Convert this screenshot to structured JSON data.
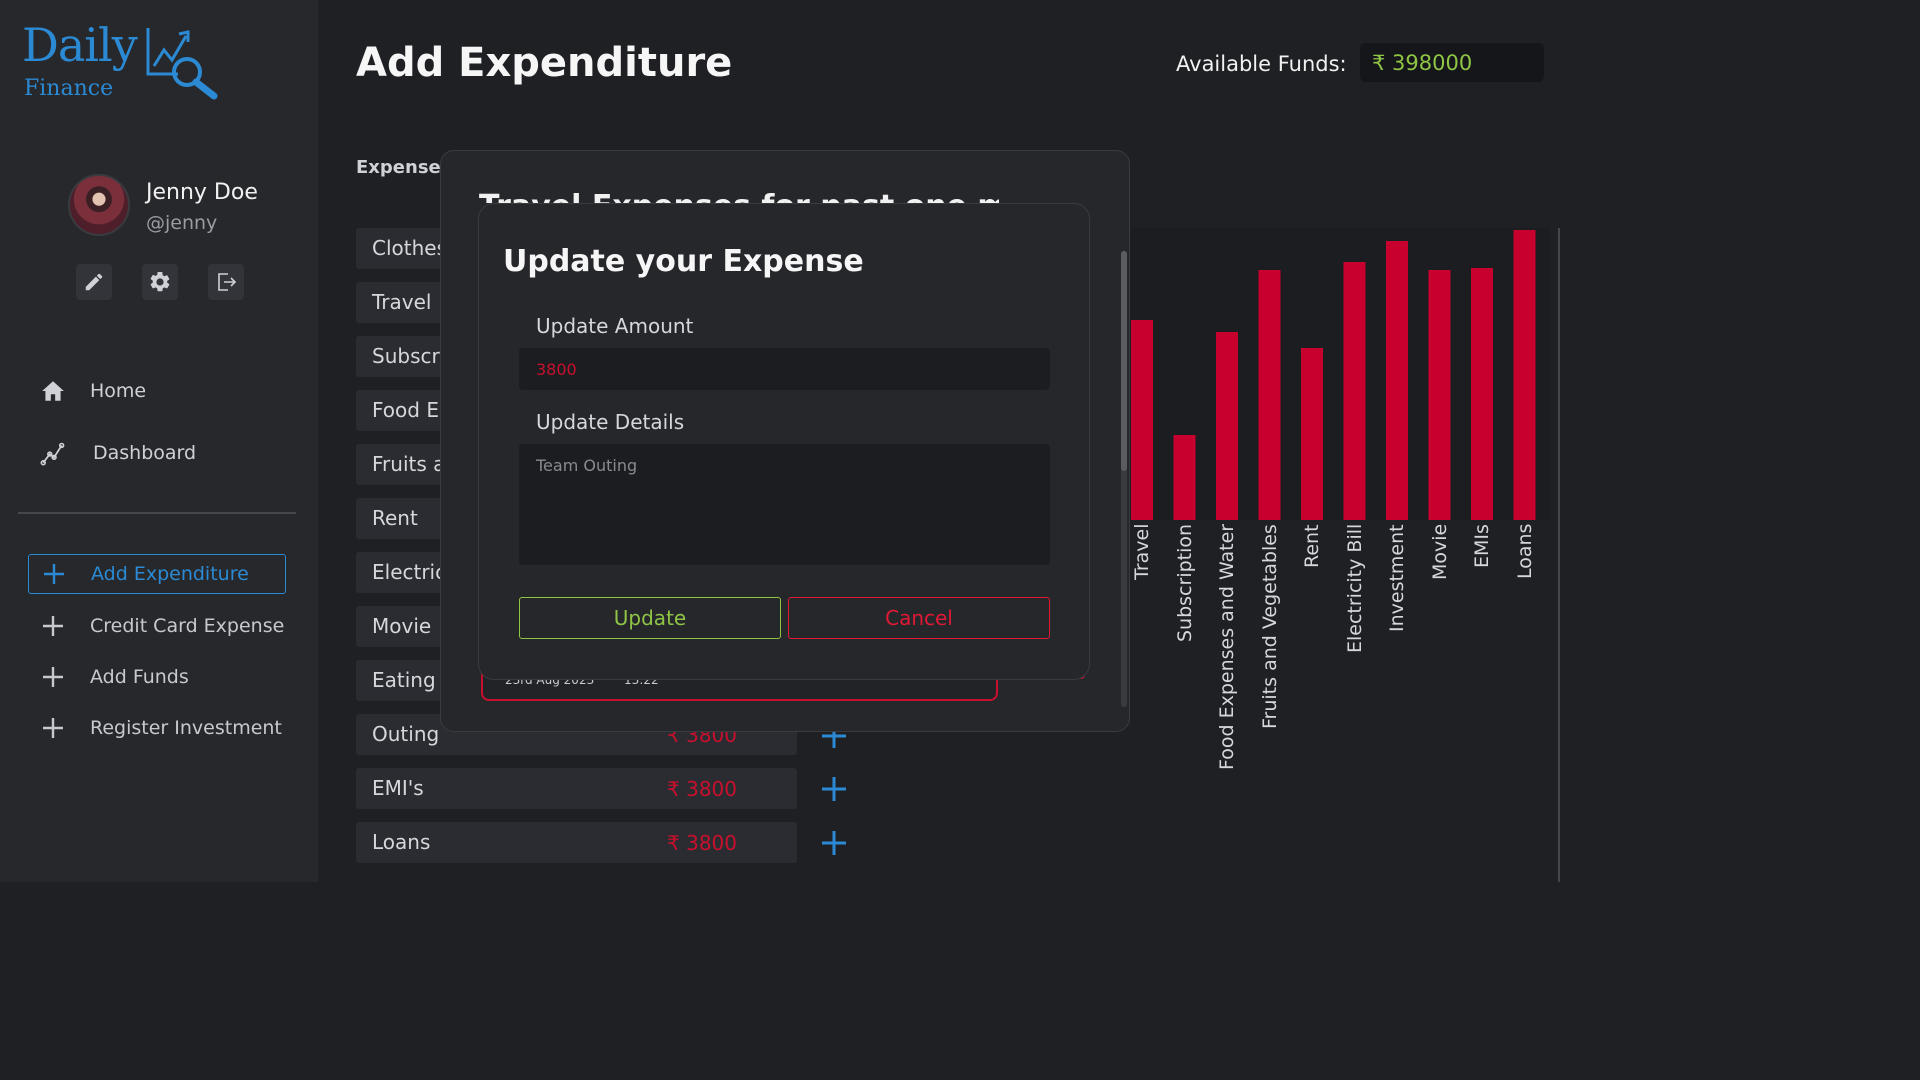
{
  "brand": {
    "name_top": "Daily",
    "name_bottom": "Finance"
  },
  "profile": {
    "name": "Jenny Doe",
    "handle": "@jenny"
  },
  "nav": [
    {
      "label": "Home",
      "icon": "home-icon"
    },
    {
      "label": "Dashboard",
      "icon": "chart-line-icon"
    }
  ],
  "side_actions": [
    {
      "label": "Add Expenditure",
      "active": true
    },
    {
      "label": "Credit Card Expense",
      "active": false
    },
    {
      "label": "Add Funds",
      "active": false
    },
    {
      "label": "Register Investment",
      "active": false
    }
  ],
  "header": {
    "title": "Add Expenditure",
    "funds_label": "Available Funds:",
    "funds_value": "₹ 398000"
  },
  "expenses": {
    "heading": "Expense D",
    "rows": [
      {
        "name": "Clothes",
        "amount": ""
      },
      {
        "name": "Travel",
        "amount": ""
      },
      {
        "name": "Subscri",
        "amount": ""
      },
      {
        "name": "Food E",
        "amount": ""
      },
      {
        "name": "Fruits a",
        "amount": ""
      },
      {
        "name": "Rent",
        "amount": ""
      },
      {
        "name": "Electric",
        "amount": ""
      },
      {
        "name": "Movie",
        "amount": ""
      },
      {
        "name": "Eating",
        "amount": ""
      },
      {
        "name": "Outing",
        "amount": "₹ 3800"
      },
      {
        "name": "EMI's",
        "amount": "₹ 3800"
      },
      {
        "name": "Loans",
        "amount": "₹ 3800"
      }
    ]
  },
  "chart_data": {
    "type": "bar",
    "categories": [
      "Travel",
      "Subscription",
      "Food Expenses and Water",
      "Fruits and Vegetables",
      "Rent",
      "Electricity Bill",
      "Investment",
      "Movie",
      "EMIs",
      "Loans"
    ],
    "values": [
      200,
      85,
      188,
      250,
      172,
      258,
      279,
      250,
      252,
      290
    ],
    "ylim": [
      0,
      292
    ],
    "bar_color": "#c8002e"
  },
  "outer_dialog": {
    "title": "Travel Expenses for past one month",
    "card_date": "23rd Aug 2023",
    "card_time": "13:22"
  },
  "modal": {
    "title": "Update your Expense",
    "amount_label": "Update Amount",
    "amount_value": "3800",
    "details_label": "Update Details",
    "details_placeholder": "Team Outing",
    "update_label": "Update",
    "cancel_label": "Cancel"
  },
  "colors": {
    "accent": "#2b8ad3",
    "success": "#8fc445",
    "danger": "#c8102e"
  }
}
